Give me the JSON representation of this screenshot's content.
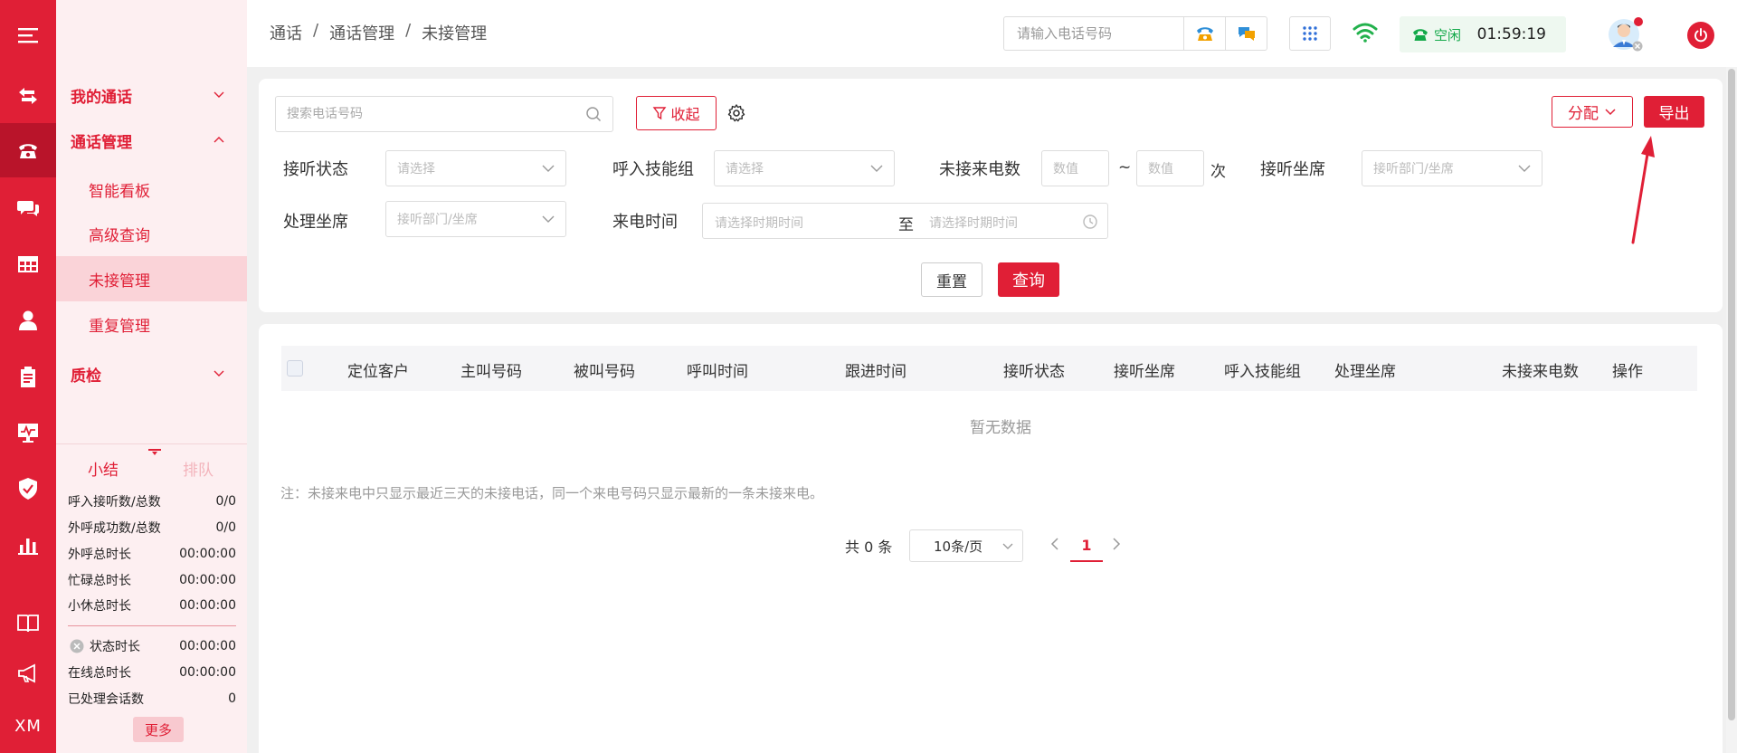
{
  "rail": {
    "brand": "XM",
    "icons": [
      "menu-icon",
      "transfer-icon",
      "phone-icon",
      "chat-icon",
      "table-icon",
      "user-icon",
      "clipboard-icon",
      "monitor-icon",
      "shield-icon",
      "bar-chart-icon",
      "book-icon",
      "megaphone-icon"
    ]
  },
  "nav": {
    "groups": [
      {
        "label": "我的通话"
      },
      {
        "label": "通话管理"
      },
      {
        "label": "质检"
      }
    ],
    "subitems": [
      {
        "label": "智能看板"
      },
      {
        "label": "高级查询"
      },
      {
        "label": "未接管理"
      },
      {
        "label": "重复管理"
      }
    ],
    "tabs": {
      "summary": "小结",
      "queue": "排队"
    },
    "stats": [
      {
        "label": "呼入接听数/总数",
        "value": "0/0"
      },
      {
        "label": "外呼成功数/总数",
        "value": "0/0"
      },
      {
        "label": "外呼总时长",
        "value": "00:00:00"
      },
      {
        "label": "忙碌总时长",
        "value": "00:00:00"
      },
      {
        "label": "小休总时长",
        "value": "00:00:00"
      },
      {
        "label": "状态时长",
        "value": "00:00:00"
      },
      {
        "label": "在线总时长",
        "value": "00:00:00"
      },
      {
        "label": "已处理会话数",
        "value": "0"
      }
    ],
    "more": "更多"
  },
  "header": {
    "breadcrumb": [
      "通话",
      "通话管理",
      "未接管理"
    ],
    "phone_placeholder": "请输入电话号码",
    "status": "空闲",
    "time": "01:59:19"
  },
  "filters": {
    "search_placeholder": "搜索电话号码",
    "collapse": "收起",
    "assign": "分配",
    "export": "导出",
    "answer_status_label": "接听状态",
    "answer_status_placeholder": "请选择",
    "skill_group_label": "呼入技能组",
    "skill_group_placeholder": "请选择",
    "missed_count_label": "未接来电数",
    "num_placeholder": "数值",
    "range_sep": "~",
    "unit": "次",
    "answer_agent_label": "接听坐席",
    "dept_agent_placeholder": "接听部门/坐席",
    "handle_agent_label": "处理坐席",
    "call_time_label": "来电时间",
    "date_placeholder": "请选择时期时间",
    "date_to": "至",
    "reset": "重置",
    "query": "查询"
  },
  "table": {
    "columns": [
      "定位客户",
      "主叫号码",
      "被叫号码",
      "呼叫时间",
      "跟进时间",
      "接听状态",
      "接听坐席",
      "呼入技能组",
      "处理坐席",
      "未接来电数",
      "操作"
    ],
    "empty": "暂无数据",
    "note": "注：未接来电中只显示最近三天的未接电话，同一个来电号码只显示最新的一条未接来电。"
  },
  "pagination": {
    "total": "共 0 条",
    "page_size": "10条/页",
    "current": "1"
  },
  "colors": {
    "brand": "#e01f36",
    "idle": "#13a94a"
  }
}
